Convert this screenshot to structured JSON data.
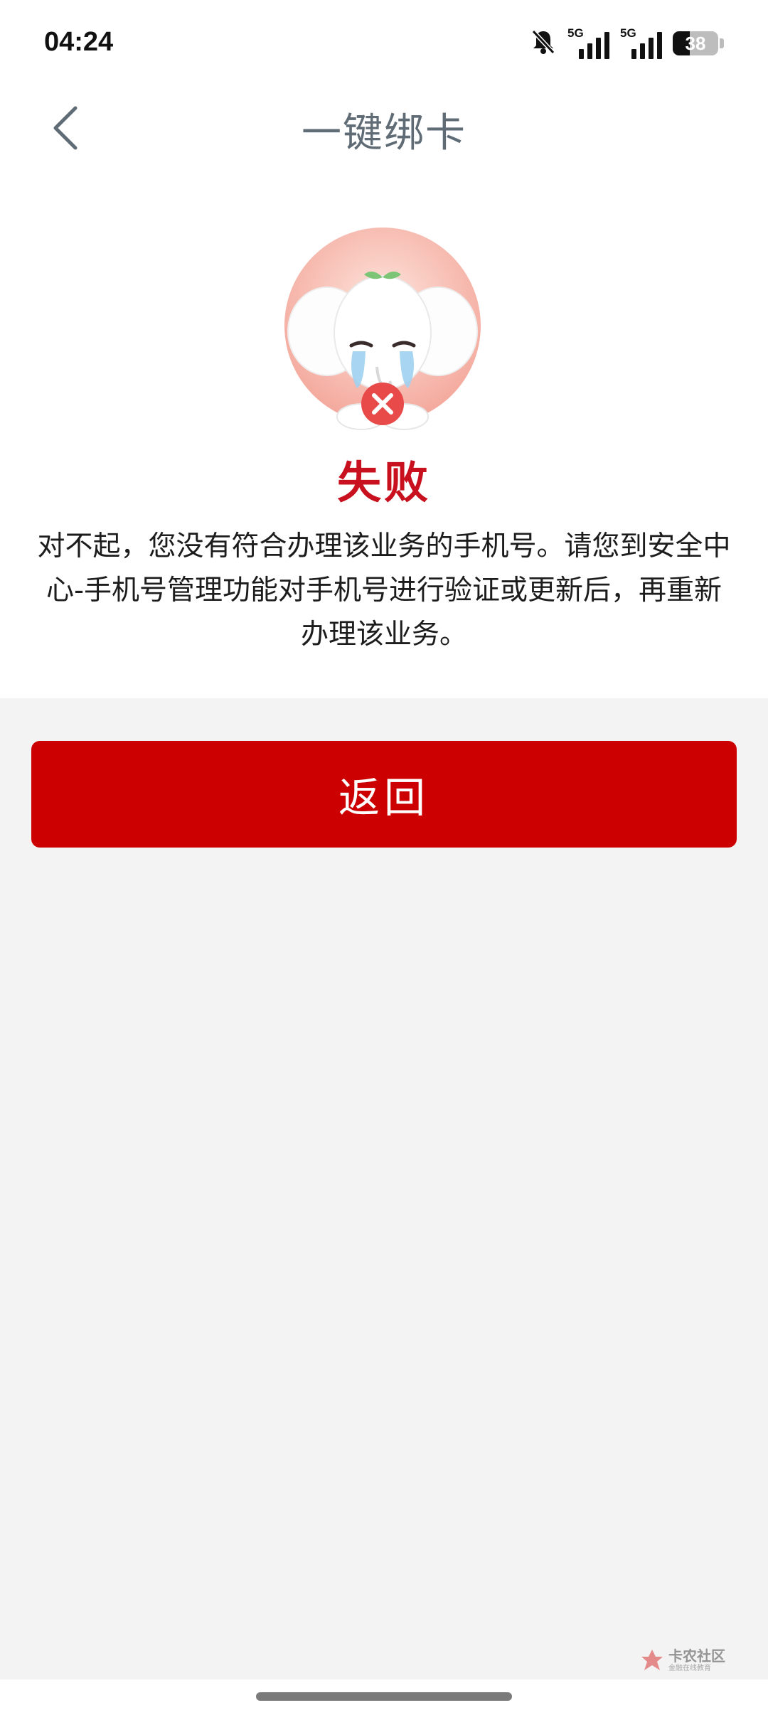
{
  "status_bar": {
    "time": "04:24",
    "signal1_label": "5G",
    "signal2_label": "5G",
    "battery_level": "38",
    "icons": [
      "bell-off-icon",
      "signal-icon",
      "signal-icon",
      "battery-icon"
    ]
  },
  "nav": {
    "back_icon": "chevron-left-icon",
    "title": "一键绑卡"
  },
  "result": {
    "icon": "crying-elephant-fail-illustration",
    "title": "失败",
    "message": "对不起，您没有符合办理该业务的手机号。请您到安全中心-手机号管理功能对手机号进行验证或更新后，再重新办理该业务。"
  },
  "actions": {
    "return_label": "返回"
  },
  "watermark": {
    "main": "卡农社区",
    "sub": "金融在线教育"
  },
  "colors": {
    "accent_red": "#cc0000",
    "title_red": "#c8101e",
    "background": "#f3f3f3",
    "panel": "#ffffff"
  }
}
